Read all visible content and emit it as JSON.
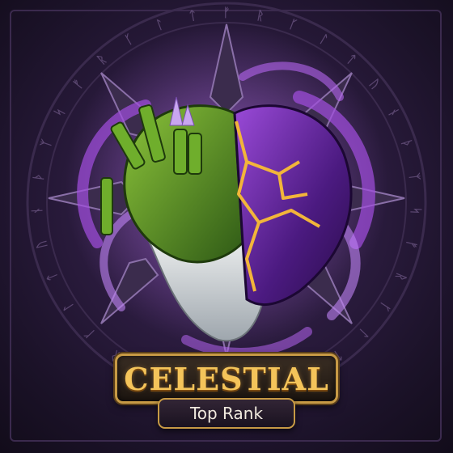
{
  "badge": {
    "title": "CELESTIAL",
    "subtitle": "Top Rank"
  },
  "colors": {
    "title_gold": "#f4c45a",
    "plate_border": "#c79a45",
    "flame_purple": "#a24fe0",
    "crystal_purple": "#6d2aa8",
    "moss_green": "#5f9a2a",
    "lava_gold": "#f2b53a"
  },
  "decor": {
    "emblem": "heart-emblem",
    "rune_glyphs": "ᚠᚱᚴᛚᛏᚢᚾᚦᛉᛋᚠᚱᚴᛚᛏᚢᚾᚦᛉᛋᚠᚱᚴᛚᛏᚢᚾᚦᛉᛋᚠᚱᚴᛚᛏ"
  }
}
